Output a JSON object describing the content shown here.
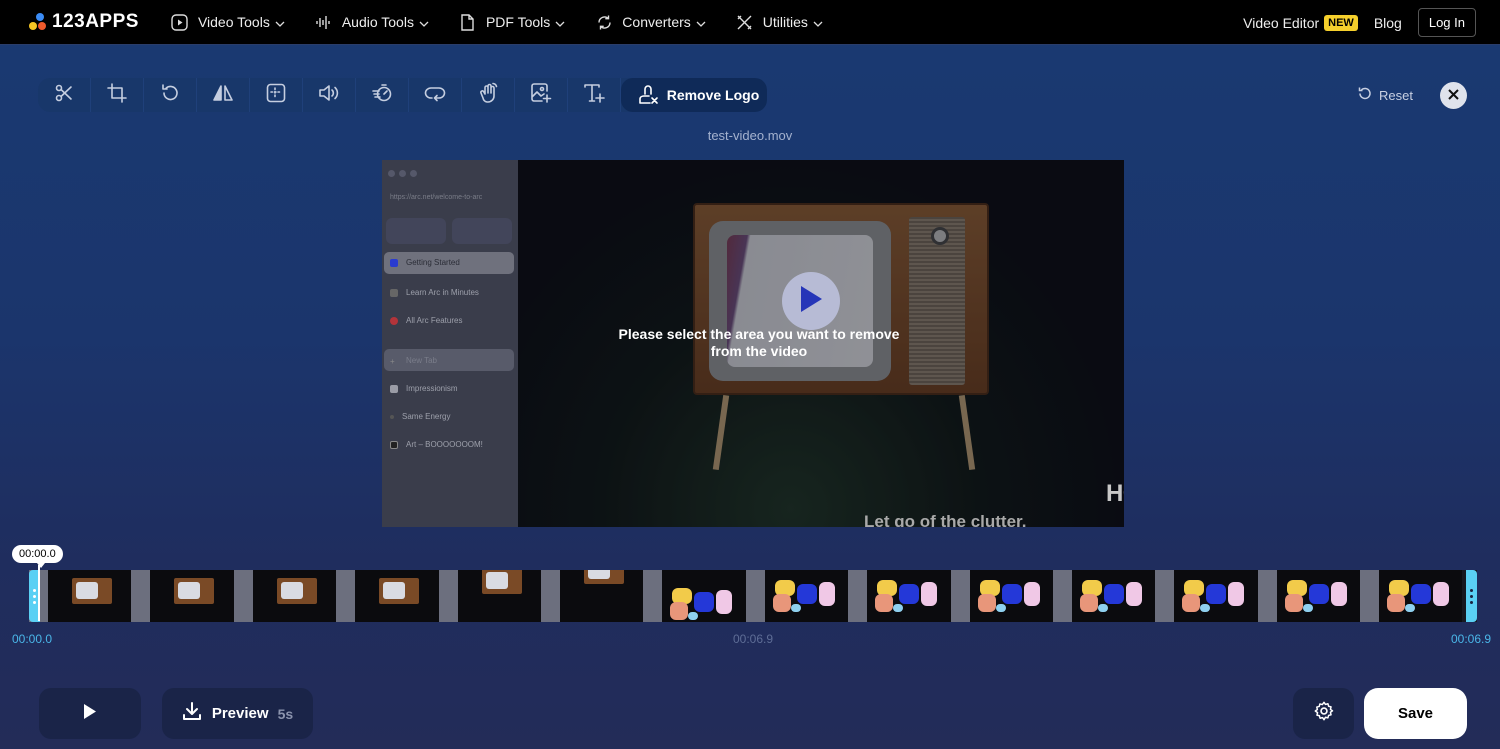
{
  "brand": {
    "name": "123APPS"
  },
  "nav": {
    "items": [
      {
        "label": "Video Tools",
        "icon": "play-square-icon"
      },
      {
        "label": "Audio Tools",
        "icon": "waveform-icon"
      },
      {
        "label": "PDF Tools",
        "icon": "document-icon"
      },
      {
        "label": "Converters",
        "icon": "refresh-icon"
      },
      {
        "label": "Utilities",
        "icon": "tools-icon"
      }
    ],
    "video_editor": "Video Editor",
    "new_badge": "NEW",
    "blog": "Blog",
    "login": "Log In"
  },
  "toolbar": {
    "tools": [
      {
        "name": "cut",
        "icon": "scissors-icon"
      },
      {
        "name": "crop",
        "icon": "crop-icon"
      },
      {
        "name": "rotate",
        "icon": "rotate-icon"
      },
      {
        "name": "flip",
        "icon": "flip-icon"
      },
      {
        "name": "resize",
        "icon": "resize-icon"
      },
      {
        "name": "volume",
        "icon": "volume-icon"
      },
      {
        "name": "speed",
        "icon": "speed-icon"
      },
      {
        "name": "loop",
        "icon": "loop-icon"
      },
      {
        "name": "stabilize",
        "icon": "hand-wave-icon"
      },
      {
        "name": "add-image",
        "icon": "add-image-icon"
      },
      {
        "name": "add-text",
        "icon": "add-text-icon"
      }
    ],
    "active_label": "Remove Logo",
    "reset_label": "Reset"
  },
  "file": {
    "name": "test-video.mov"
  },
  "video": {
    "instruction": "Please select the area you want to remove from the video",
    "watermark": "HONGKIAT",
    "caption": "Let go of the clutter.",
    "browser_url": "https://arc.net/welcome-to-arc",
    "sidebar_items": [
      "Getting Started",
      "Learn Arc in Minutes",
      "All Arc Features",
      "New Tab",
      "Impressionism",
      "Same Energy",
      "Art – BOOOOOOOM!"
    ]
  },
  "timeline": {
    "current": "00:00.0",
    "start": "00:00.0",
    "mid": "00:06.9",
    "end": "00:06.9",
    "trim_range": [
      0,
      1
    ]
  },
  "bottom": {
    "preview_label": "Preview",
    "preview_duration": "5s",
    "save_label": "Save"
  }
}
